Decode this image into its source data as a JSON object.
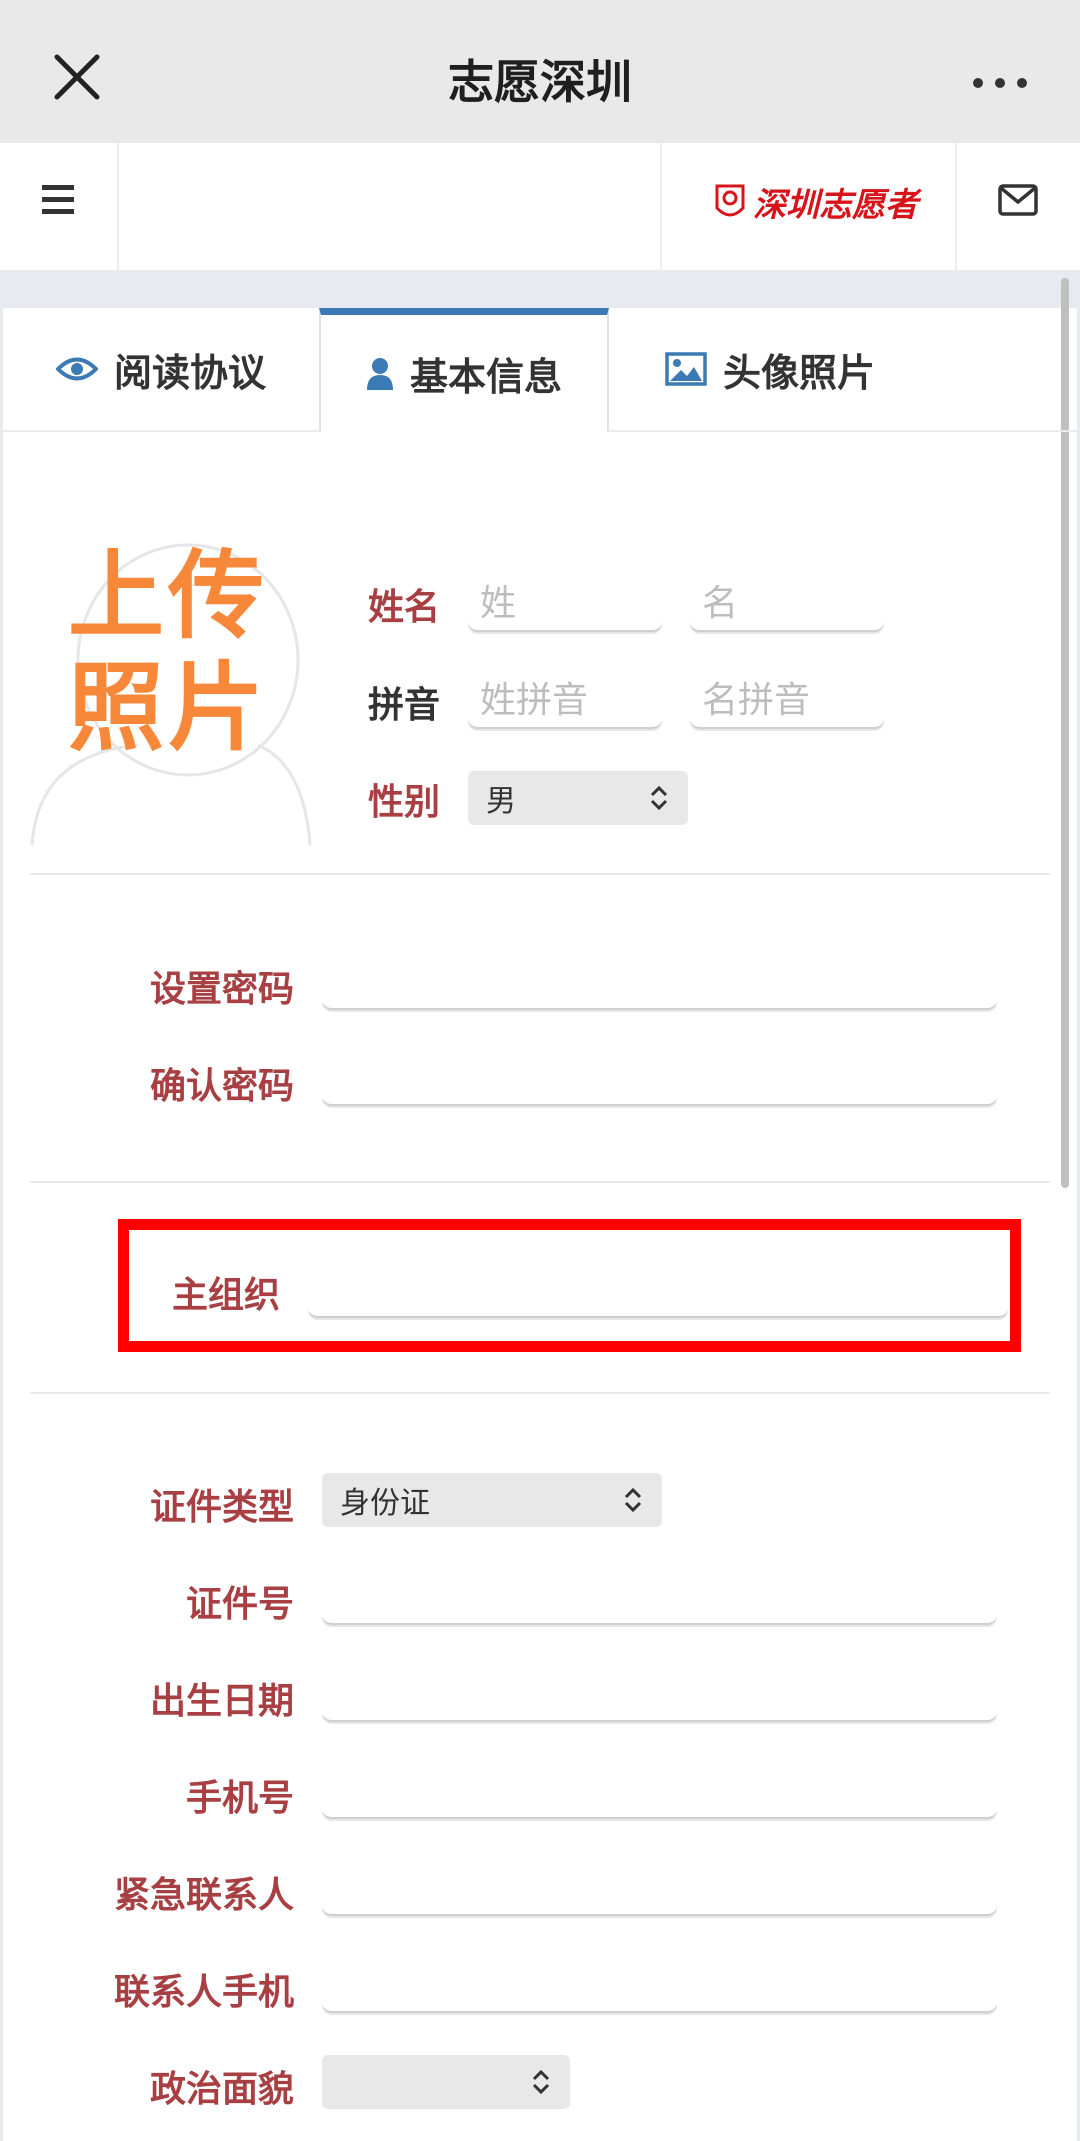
{
  "wechat_bar": {
    "title": "志愿深圳"
  },
  "header": {
    "logo_text": "深圳志愿者"
  },
  "tabs": [
    {
      "label": "阅读协议",
      "icon": "eye-icon"
    },
    {
      "label": "基本信息",
      "icon": "user-icon",
      "active": true
    },
    {
      "label": "头像照片",
      "icon": "image-icon"
    }
  ],
  "photo": {
    "line1": "上传",
    "line2": "照片"
  },
  "name_section": {
    "name_label": "姓名",
    "surname_placeholder": "姓",
    "given_placeholder": "名",
    "pinyin_label": "拼音",
    "surname_pinyin_placeholder": "姓拼音",
    "given_pinyin_placeholder": "名拼音",
    "gender_label": "性别",
    "gender_value": "男"
  },
  "password_section": {
    "set_label": "设置密码",
    "confirm_label": "确认密码"
  },
  "org_section": {
    "label": "主组织",
    "value": ""
  },
  "id_section": {
    "id_type_label": "证件类型",
    "id_type_value": "身份证",
    "id_number_label": "证件号",
    "birth_label": "出生日期",
    "phone_label": "手机号",
    "emergency_label": "紧急联系人",
    "emergency_phone_label": "联系人手机",
    "political_label": "政治面貌",
    "political_value": ""
  },
  "colors": {
    "label_red": "#a83f43",
    "tab_accent": "#3b7ab5",
    "photo_orange": "#f7883a",
    "highlight": "#ff0000",
    "logo_red": "#d8141b"
  }
}
